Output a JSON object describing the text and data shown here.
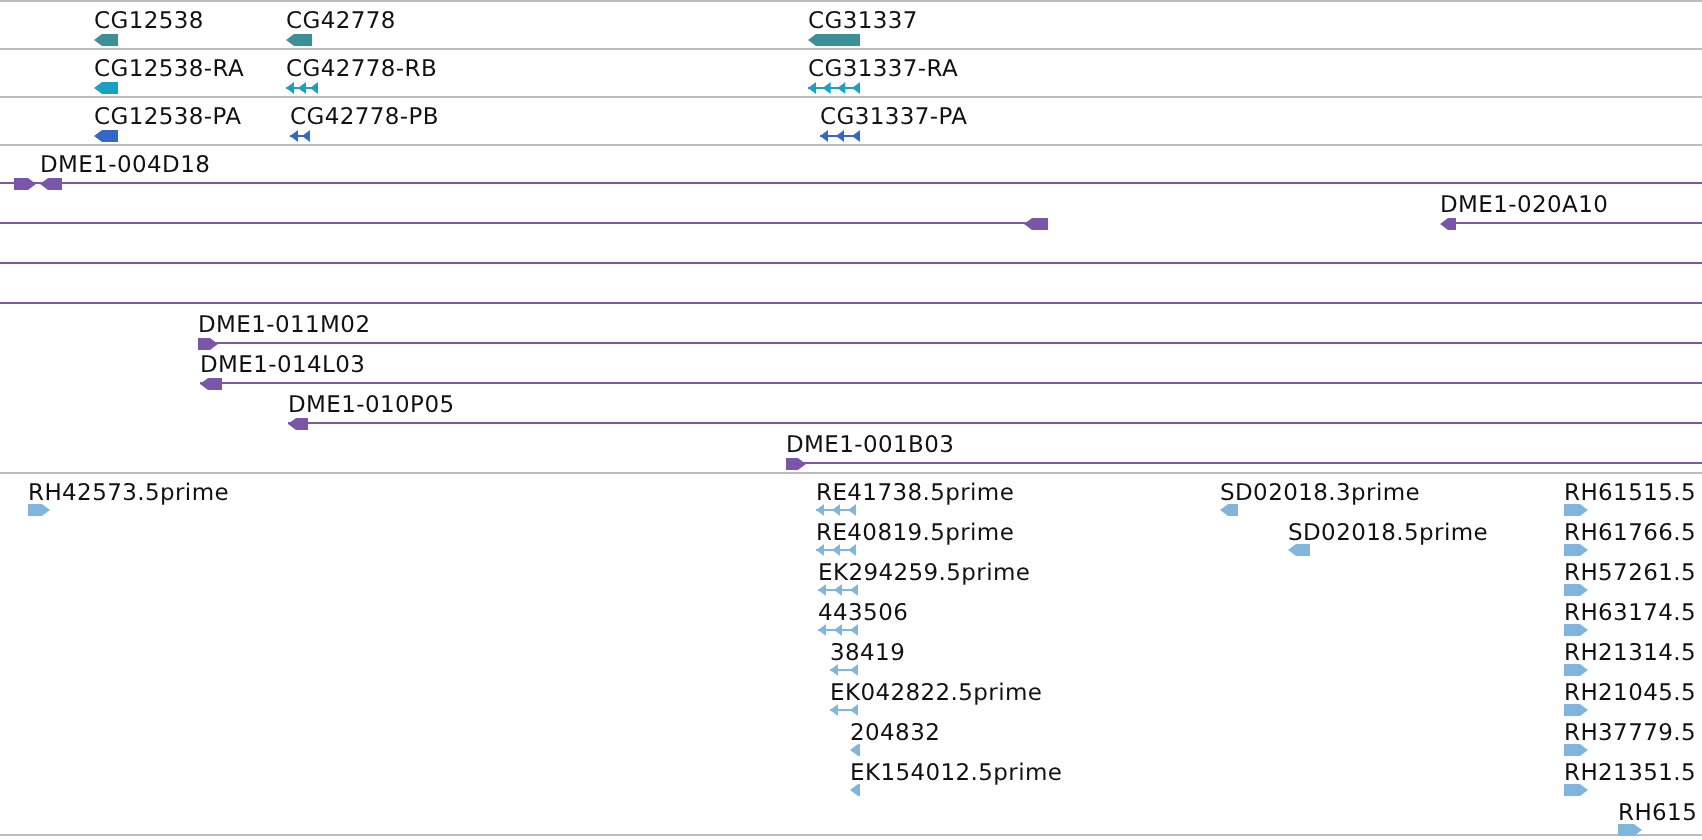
{
  "tracks": [
    {
      "kind": "gene",
      "rows": [
        {
          "features": [
            {
              "label": "CG12538",
              "reverse": true,
              "kind": "block"
            },
            {
              "label": "CG42778",
              "reverse": true,
              "kind": "block"
            },
            {
              "label": "CG31337",
              "reverse": true,
              "kind": "block"
            }
          ]
        },
        {
          "features": [
            {
              "label": "CG12538-RA",
              "reverse": true,
              "kind": "block"
            },
            {
              "label": "CG42778-RB",
              "reverse": true,
              "kind": "segmented"
            },
            {
              "label": "CG31337-RA",
              "reverse": true,
              "kind": "segmented"
            }
          ]
        },
        {
          "features": [
            {
              "label": "CG12538-PA",
              "reverse": true,
              "kind": "block"
            },
            {
              "label": "CG42778-PB",
              "reverse": true,
              "kind": "segmented"
            },
            {
              "label": "CG31337-PA",
              "reverse": true,
              "kind": "segmented"
            }
          ]
        }
      ]
    },
    {
      "kind": "clone",
      "rows": [
        {
          "features": [
            {
              "reverse": false,
              "kind": "block"
            },
            {
              "label": "DME1-004D18",
              "reverse": true,
              "kind": "block"
            }
          ]
        },
        {
          "features": [
            {
              "reverse": true,
              "kind": "block"
            },
            {
              "label": "DME1-020A10",
              "reverse": true,
              "kind": "block"
            }
          ]
        },
        {
          "features": [
            {
              "label": "DME1-011M02",
              "reverse": false,
              "kind": "block"
            }
          ]
        },
        {
          "features": [
            {
              "label": "DME1-014L03",
              "reverse": true,
              "kind": "block"
            }
          ]
        },
        {
          "features": [
            {
              "label": "DME1-010P05",
              "reverse": true,
              "kind": "block"
            }
          ]
        },
        {
          "features": [
            {
              "label": "DME1-001B03",
              "reverse": false,
              "kind": "block"
            }
          ]
        }
      ]
    },
    {
      "kind": "est",
      "rows": [
        {
          "features": [
            {
              "label": "RH42573.5prime",
              "reverse": false,
              "kind": "block"
            },
            {
              "label": "RE41738.5prime",
              "reverse": true,
              "kind": "segmented"
            },
            {
              "label": "SD02018.3prime",
              "reverse": true,
              "kind": "block"
            },
            {
              "label": "RH61515.5",
              "reverse": false,
              "kind": "block"
            }
          ]
        },
        {
          "features": [
            {
              "label": "RE40819.5prime",
              "reverse": true,
              "kind": "segmented"
            },
            {
              "label": "SD02018.5prime",
              "reverse": true,
              "kind": "block"
            },
            {
              "label": "RH61766.5",
              "reverse": false,
              "kind": "block"
            }
          ]
        },
        {
          "features": [
            {
              "label": "EK294259.5prime",
              "reverse": true,
              "kind": "segmented"
            },
            {
              "label": "RH57261.5",
              "reverse": false,
              "kind": "block"
            }
          ]
        },
        {
          "features": [
            {
              "label": "443506",
              "reverse": true,
              "kind": "segmented"
            },
            {
              "label": "RH63174.5",
              "reverse": false,
              "kind": "block"
            }
          ]
        },
        {
          "features": [
            {
              "label": "38419",
              "reverse": true,
              "kind": "segmented"
            },
            {
              "label": "RH21314.5",
              "reverse": false,
              "kind": "block"
            }
          ]
        },
        {
          "features": [
            {
              "label": "EK042822.5prime",
              "reverse": true,
              "kind": "segmented"
            },
            {
              "label": "RH21045.5",
              "reverse": false,
              "kind": "block"
            }
          ]
        },
        {
          "features": [
            {
              "label": "204832",
              "reverse": true,
              "kind": "block"
            },
            {
              "label": "RH37779.5",
              "reverse": false,
              "kind": "block"
            }
          ]
        },
        {
          "features": [
            {
              "label": "EK154012.5prime",
              "reverse": true,
              "kind": "block"
            },
            {
              "label": "RH21351.5",
              "reverse": false,
              "kind": "block"
            }
          ]
        },
        {
          "features": [
            {
              "label": "RH615",
              "reverse": false,
              "kind": "block"
            }
          ]
        }
      ]
    }
  ]
}
